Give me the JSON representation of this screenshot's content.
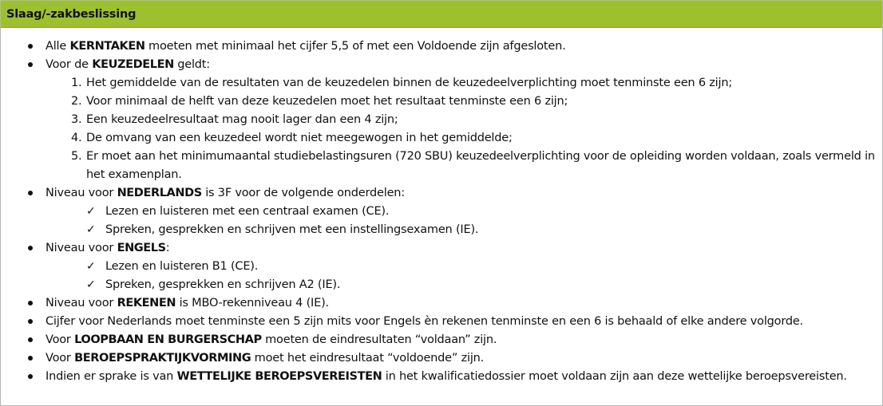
{
  "header": {
    "title": "Slaag/-zakbeslissing"
  },
  "items": {
    "kerntaken": {
      "pre": "Alle ",
      "bold": "KERNTAKEN",
      "post": " moeten met minimaal het cijfer 5,5 of met een Voldoende zijn afgesloten."
    },
    "keuzedelen": {
      "pre": "Voor de ",
      "bold": "KEUZEDELEN",
      "post": " geldt:",
      "subitems": [
        {
          "num": "1.",
          "text": "Het gemiddelde van de resultaten van de keuzedelen binnen de keuzedeelverplichting moet tenminste een 6 zijn;"
        },
        {
          "num": "2.",
          "text": "Voor minimaal de helft van deze keuzedelen moet het resultaat tenminste een 6 zijn;"
        },
        {
          "num": "3.",
          "text": "Een keuzedeelresultaat mag nooit lager dan een 4 zijn;"
        },
        {
          "num": "4.",
          "text": "De omvang van een keuzedeel wordt niet meegewogen in het gemiddelde;"
        },
        {
          "num": "5.",
          "text": "Er moet aan het minimumaantal studiebelastingsuren (720 SBU) keuzedeelverplichting voor de opleiding worden voldaan, zoals vermeld in",
          "text2": "het examenplan."
        }
      ]
    },
    "nederlands": {
      "pre": "Niveau voor ",
      "bold": "NEDERLANDS",
      "post": " is 3F voor de volgende onderdelen:",
      "checks": [
        "Lezen en luisteren met een centraal examen (CE).",
        "Spreken, gesprekken en schrijven met een instellingsexamen (IE)."
      ]
    },
    "engels": {
      "pre": "Niveau voor ",
      "bold": "ENGELS",
      "post": ":",
      "checks": [
        "Lezen en luisteren B1 (CE).",
        "Spreken, gesprekken en schrijven A2 (IE)."
      ]
    },
    "rekenen": {
      "pre": "Niveau voor ",
      "bold": "REKENEN",
      "post": " is MBO-rekenniveau 4 (IE)."
    },
    "cijfer": {
      "text": "Cijfer voor Nederlands moet tenminste een 5 zijn mits voor Engels èn rekenen tenminste en een 6 is behaald of elke andere volgorde."
    },
    "loopbaan": {
      "pre": "Voor ",
      "bold": "LOOPBAAN EN BURGERSCHAP",
      "post": " moeten de eindresultaten “voldaan” zijn."
    },
    "bpv": {
      "pre": "Voor ",
      "bold": "BEROEPSPRAKTIJKVORMING",
      "post": " moet het eindresultaat “voldoende” zijn."
    },
    "wettelijk": {
      "pre": "Indien er sprake is van ",
      "bold": "WETTELIJKE BEROEPSVEREISTEN",
      "post": " in het kwalificatiedossier moet voldaan zijn aan deze wettelijke beroepsvereisten."
    }
  },
  "check_symbol": "✓"
}
